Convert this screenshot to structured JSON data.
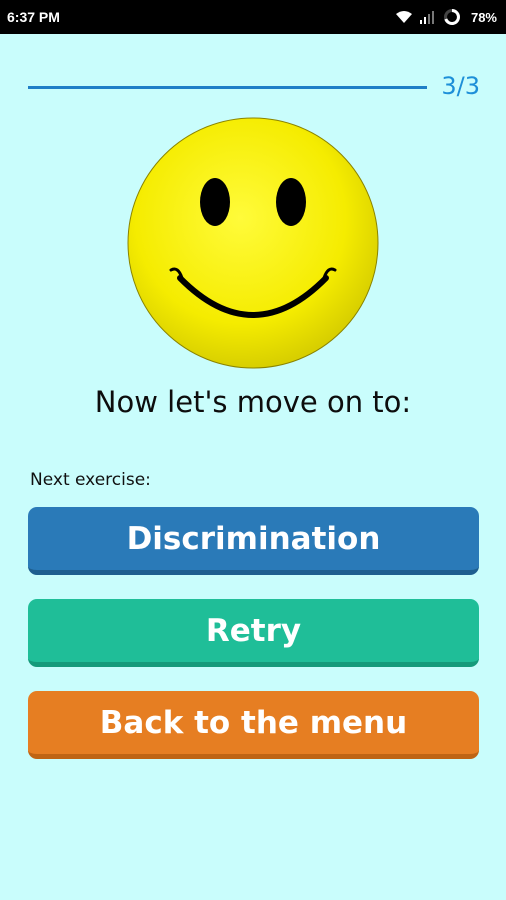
{
  "status_bar": {
    "time": "6:37 PM",
    "battery": "78%",
    "icons": [
      "wifi-icon",
      "signal-icon",
      "battery-ring-icon"
    ]
  },
  "progress": {
    "label": "3/3",
    "current": 3,
    "total": 3
  },
  "smiley": {
    "icon": "smiley-face-icon",
    "face_color": "#f7ef00",
    "feature_color": "#000000"
  },
  "headline": "Now let's move on to:",
  "next_exercise_label": "Next exercise:",
  "buttons": {
    "discrimination": {
      "label": "Discrimination",
      "color": "#2a7ab8"
    },
    "retry": {
      "label": "Retry",
      "color": "#1fbe98"
    },
    "menu": {
      "label": "Back to the menu",
      "color": "#e67e22"
    }
  },
  "colors": {
    "background": "#c9fdfc",
    "accent": "#1d8fd8"
  }
}
